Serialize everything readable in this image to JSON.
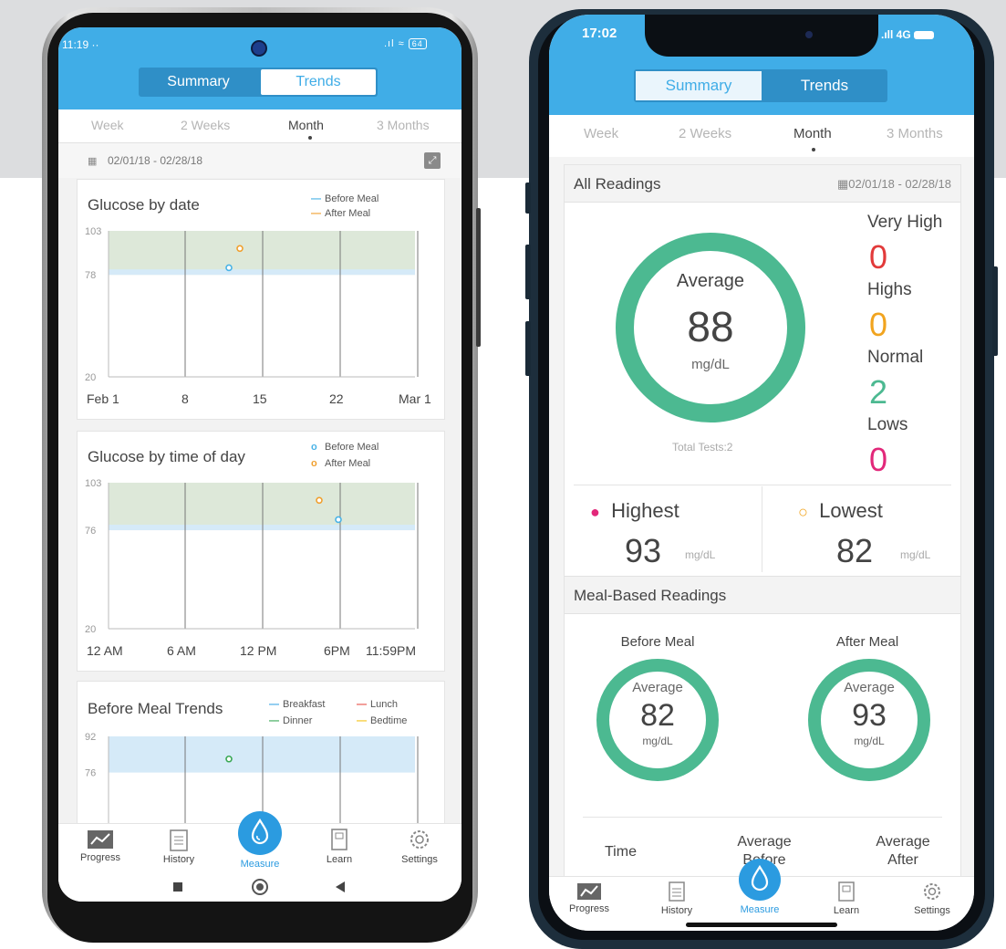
{
  "colors": {
    "header_blue": "#40ade7",
    "ring_green": "#4cb991",
    "very_high_red": "#e23a3a",
    "high_orange": "#f1a41f",
    "normal_green": "#4cb991",
    "low_pink": "#e2287a",
    "before_meal_blue": "#4ab3e6",
    "after_meal_orange": "#f0a030",
    "breakfast_blue": "#3fa8e6",
    "lunch_red": "#e8524a",
    "dinner_green": "#3aa855",
    "bedtime_yellow": "#f5c419",
    "target_band_green": "#dde8d9",
    "target_band_blue": "#d5eaf8"
  },
  "left_phone": {
    "status": {
      "time": "11:19",
      "dots": "··",
      "battery": "64"
    },
    "tabs": {
      "summary": "Summary",
      "trends": "Trends"
    },
    "ranges": [
      "Week",
      "2 Weeks",
      "Month",
      "3 Months"
    ],
    "active_range": "Month",
    "date_range": "02/01/18 - 02/28/18",
    "chart_data": [
      {
        "type": "scatter",
        "title": "Glucose by date",
        "legend": [
          "Before Meal",
          "After Meal"
        ],
        "y_ticks": [
          "103",
          "78",
          "20"
        ],
        "x_ticks": [
          "Feb 1",
          "8",
          "15",
          "22",
          "Mar 1"
        ],
        "ylim": [
          20,
          103
        ],
        "target_range": [
          78,
          103
        ],
        "series": [
          {
            "name": "Before Meal",
            "points": [
              {
                "x": 12,
                "y": 82
              }
            ]
          },
          {
            "name": "After Meal",
            "points": [
              {
                "x": 13,
                "y": 93
              }
            ]
          }
        ]
      },
      {
        "type": "scatter",
        "title": "Glucose by time of day",
        "legend": [
          "Before Meal",
          "After Meal"
        ],
        "y_ticks": [
          "103",
          "76",
          "20"
        ],
        "x_ticks": [
          "12 AM",
          "6 AM",
          "12 PM",
          "6PM",
          "11:59PM"
        ],
        "ylim": [
          20,
          103
        ],
        "target_range": [
          76,
          103
        ],
        "series": [
          {
            "name": "Before Meal",
            "points": [
              {
                "x": 18,
                "y": 82
              }
            ]
          },
          {
            "name": "After Meal",
            "points": [
              {
                "x": 16.5,
                "y": 93
              }
            ]
          }
        ]
      },
      {
        "type": "scatter",
        "title": "Before Meal Trends",
        "legend": [
          "Breakfast",
          "Lunch",
          "Dinner",
          "Bedtime"
        ],
        "y_ticks": [
          "92",
          "76"
        ],
        "target_range": [
          76,
          92
        ],
        "series": [
          {
            "name": "Dinner",
            "points": [
              {
                "x": 12,
                "y": 82
              }
            ]
          }
        ]
      }
    ],
    "nav": [
      "Progress",
      "History",
      "Measure",
      "Learn",
      "Settings"
    ]
  },
  "right_phone": {
    "status": {
      "time": "17:02",
      "network": "4G"
    },
    "tabs": {
      "summary": "Summary",
      "trends": "Trends"
    },
    "ranges": [
      "Week",
      "2 Weeks",
      "Month",
      "3 Months"
    ],
    "active_range": "Month",
    "all_readings": {
      "title": "All Readings",
      "date_range": "02/01/18 - 02/28/18",
      "average_label": "Average",
      "average_value": "88",
      "unit": "mg/dL",
      "total_tests": "Total Tests:2",
      "levels": [
        {
          "label": "Very High",
          "value": "0"
        },
        {
          "label": "Highs",
          "value": "0"
        },
        {
          "label": "Normal",
          "value": "2"
        },
        {
          "label": "Lows",
          "value": "0"
        }
      ],
      "highest": {
        "label": "Highest",
        "value": "93",
        "unit": "mg/dL"
      },
      "lowest": {
        "label": "Lowest",
        "value": "82",
        "unit": "mg/dL"
      }
    },
    "meal_based": {
      "title": "Meal-Based Readings",
      "before": {
        "label": "Before Meal",
        "avg_label": "Average",
        "value": "82",
        "unit": "mg/dL"
      },
      "after": {
        "label": "After Meal",
        "avg_label": "Average",
        "value": "93",
        "unit": "mg/dL"
      }
    },
    "table_head": {
      "time": "Time",
      "avg_before": "Average Before",
      "avg_after": "Average After"
    },
    "nav": [
      "Progress",
      "History",
      "Measure",
      "Learn",
      "Settings"
    ]
  }
}
